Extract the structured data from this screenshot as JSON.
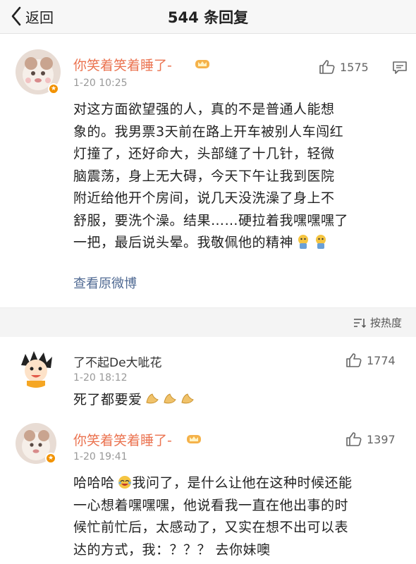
{
  "header": {
    "back_label": "返回",
    "title": "544 条回复"
  },
  "main_post": {
    "username": "你笑着笑着睡了-",
    "time": "1-20 10:25",
    "likes": "1575",
    "text_lines": [
      "对这方面欲望强的人，真的不是普通人能想",
      "象的。我男票3天前在路上开车被别人车闯红",
      "灯撞了，还好命大，头部缝了十几针，轻微",
      "脑震荡，身上无大碍，今天下午让我到医院",
      "附近给他开个房间，说几天没洗澡了身上不",
      "舒服，要洗个澡。结果……硬拉着我嘿嘿嘿了",
      "一把，最后说头晕。我敬佩他的精神"
    ],
    "view_original": "查看原微博"
  },
  "sort_label": "按热度",
  "comments": [
    {
      "username": "了不起De大呲花",
      "time": "1-20 18:12",
      "likes": "1774",
      "text": "死了都要爱"
    },
    {
      "username": "你笑着笑着睡了-",
      "time": "1-20 19:41",
      "likes": "1397",
      "text_lines": [
        "哈哈哈",
        "我问了，是什么让他在这种时候还能",
        "一心想着嘿嘿嘿，他说看我一直在他出事的时",
        "候忙前忙后，太感动了，又实在想不出可以表",
        "达的方式，我：？？？ 去你妹噢"
      ]
    }
  ],
  "colors": {
    "username": "#eb7350",
    "link": "#506a93",
    "meta": "#999999",
    "separator": "#f4f4f4"
  },
  "icons": [
    "back-chevron-icon",
    "thumbs-up-icon",
    "comment-icon",
    "crown-icon",
    "sort-icon",
    "verified-badge-icon",
    "emoji-icon"
  ]
}
